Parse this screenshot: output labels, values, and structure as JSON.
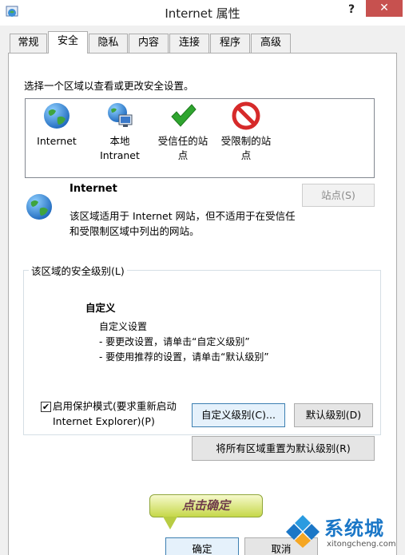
{
  "window": {
    "title": "Internet 属性",
    "help": "?",
    "close": "✕"
  },
  "tabs": [
    "常规",
    "安全",
    "隐私",
    "内容",
    "连接",
    "程序",
    "高级"
  ],
  "active_tab": "安全",
  "zones": {
    "instruction": "选择一个区域以查看或更改安全设置。",
    "items": [
      {
        "line1": "Internet",
        "line2": "",
        "icon": "globe-icon"
      },
      {
        "line1": "本地",
        "line2": "Intranet",
        "icon": "intranet-icon"
      },
      {
        "line1": "受信任的站",
        "line2": "点",
        "icon": "checkmark-icon"
      },
      {
        "line1": "受限制的站",
        "line2": "点",
        "icon": "restricted-icon"
      }
    ]
  },
  "selected_zone": {
    "title": "Internet",
    "desc_line1": "该区域适用于 Internet 网站，但不适用于在受信任",
    "desc_line2": "和受限制区域中列出的网站。",
    "sites_button": "站点(S)"
  },
  "security_level": {
    "group_label": "该区域的安全级别(L)",
    "level_name": "自定义",
    "line1": "自定义设置",
    "line2": "- 要更改设置，请单击“自定义级别”",
    "line3": "- 要使用推荐的设置，请单击“默认级别”",
    "protected_mode_line1": "启用保护模式(要求重新启动",
    "protected_mode_line2": "Internet Explorer)(P)",
    "protected_mode_checked": true,
    "custom_button": "自定义级别(C)...",
    "default_button": "默认级别(D)"
  },
  "reset_button": "将所有区域重置为默认级别(R)",
  "annotation": "点击确定",
  "ok_button": "确定",
  "cancel_button": "取消",
  "watermark": {
    "name": "系统城",
    "url": "xitongcheng.com"
  },
  "colors": {
    "close": "#c7514f",
    "accent": "#3c7fb1",
    "check_green": "#2fa52f",
    "restricted_red": "#d62a2a"
  }
}
